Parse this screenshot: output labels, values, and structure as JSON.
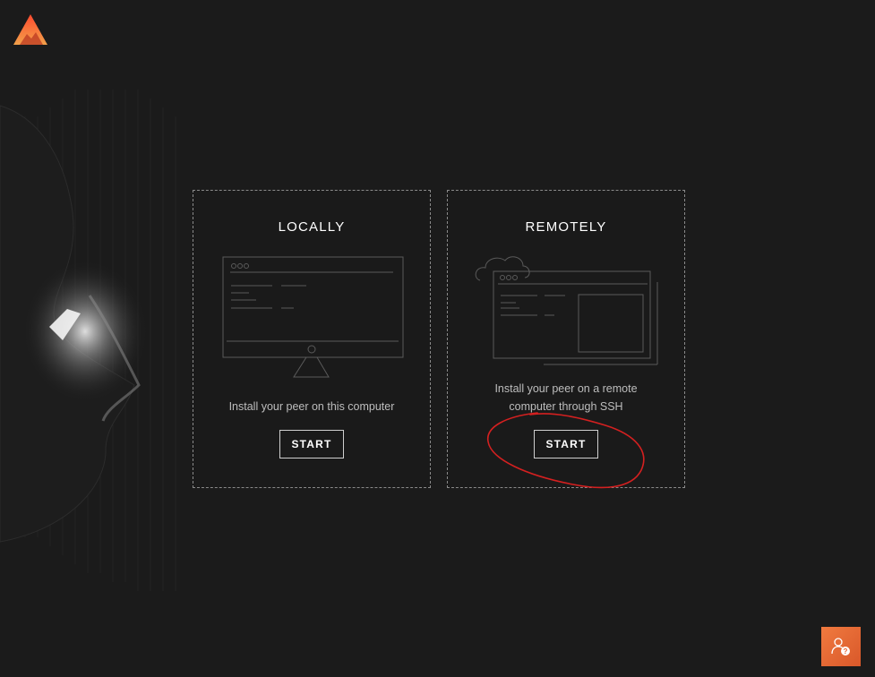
{
  "cards": [
    {
      "title": "LOCALLY",
      "description": "Install your peer on this computer",
      "button_label": "START",
      "illustration": "desktop-monitor-icon"
    },
    {
      "title": "REMOTELY",
      "description": "Install your peer on a remote computer through SSH",
      "button_label": "START",
      "illustration": "cloud-server-window-icon"
    }
  ],
  "logo_icon": "mountain-logo-icon",
  "help_icon": "user-help-icon",
  "colors": {
    "background": "#1b1b1b",
    "accent": "#e8612f",
    "annotation": "#d42020",
    "card_border": "#8a8a8a",
    "muted_text": "#bdbdbd"
  }
}
